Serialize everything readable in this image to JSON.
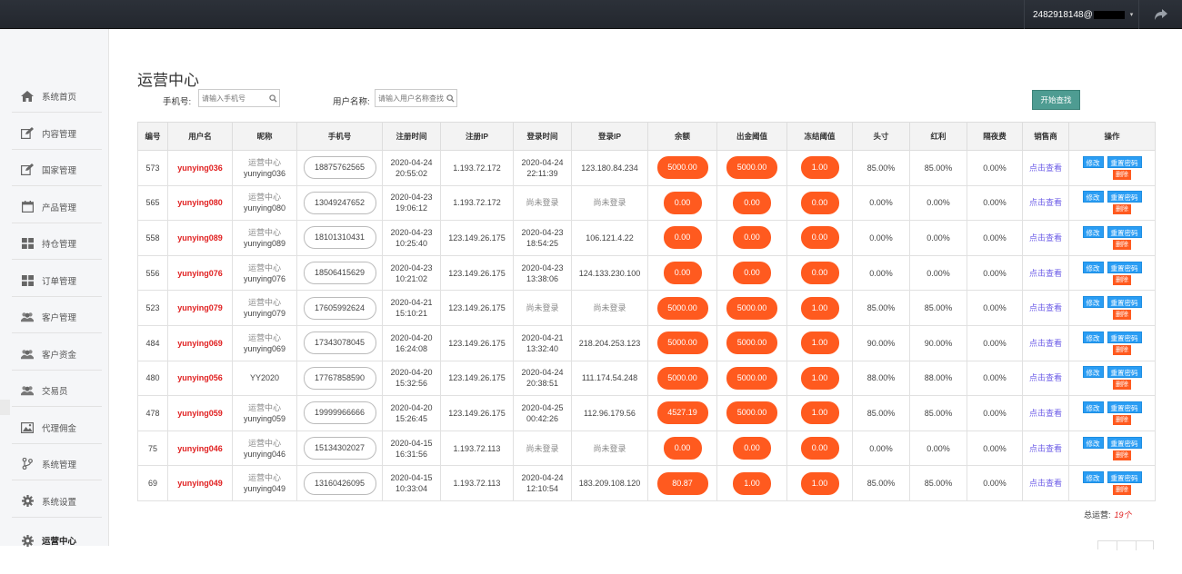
{
  "topbar": {
    "user": "2482918148@",
    "caret": "▾"
  },
  "sidebar": {
    "items": [
      {
        "label": "系统首页",
        "icon": "home-icon"
      },
      {
        "label": "内容管理",
        "icon": "edit-icon"
      },
      {
        "label": "国家管理",
        "icon": "edit-icon"
      },
      {
        "label": "产品管理",
        "icon": "calendar-icon"
      },
      {
        "label": "持仓管理",
        "icon": "grid-icon"
      },
      {
        "label": "订单管理",
        "icon": "grid-icon"
      },
      {
        "label": "客户管理",
        "icon": "users-icon"
      },
      {
        "label": "客户资金",
        "icon": "users-icon"
      },
      {
        "label": "交易员",
        "icon": "users-icon"
      },
      {
        "label": "代理佣金",
        "icon": "image-icon"
      },
      {
        "label": "系统管理",
        "icon": "branch-icon"
      },
      {
        "label": "系统设置",
        "icon": "gear-icon"
      },
      {
        "label": "运营中心",
        "icon": "gear-icon"
      }
    ]
  },
  "page": {
    "title": "运营中心",
    "phone_label": "手机号:",
    "phone_placeholder": "请输入手机号",
    "user_label": "用户名称:",
    "user_placeholder": "请输入用户名称查找",
    "search_button": "开始查找"
  },
  "table": {
    "headers": [
      "编号",
      "用户名",
      "昵称",
      "手机号",
      "注册时间",
      "注册IP",
      "登录时间",
      "登录IP",
      "余额",
      "出金阈值",
      "冻结阈值",
      "头寸",
      "红利",
      "隔夜费",
      "销售商",
      "操作"
    ],
    "view_label": "点击查看",
    "edit_label": "修改",
    "reset_label": "重置密码",
    "delete_label": "删除",
    "rows": [
      {
        "id": "573",
        "username": "yunying036",
        "nick1": "运营中心",
        "nick2": "yunying036",
        "phone": "18875762565",
        "reg_date": "2020-04-24",
        "reg_time": "20:55:02",
        "reg_ip": "1.193.72.172",
        "login_date": "2020-04-24",
        "login_time": "22:11:39",
        "login_ip": "123.180.84.234",
        "balance": "5000.00",
        "withdraw": "5000.00",
        "freeze": "1.00",
        "position": "85.00%",
        "bonus": "85.00%",
        "overnight": "0.00%"
      },
      {
        "id": "565",
        "username": "yunying080",
        "nick1": "运营中心",
        "nick2": "yunying080",
        "phone": "13049247652",
        "reg_date": "2020-04-23",
        "reg_time": "19:06:12",
        "reg_ip": "1.193.72.172",
        "login_date": "尚未登录",
        "login_time": "",
        "login_ip": "尚未登录",
        "balance": "0.00",
        "withdraw": "0.00",
        "freeze": "0.00",
        "position": "0.00%",
        "bonus": "0.00%",
        "overnight": "0.00%"
      },
      {
        "id": "558",
        "username": "yunying089",
        "nick1": "运营中心",
        "nick2": "yunying089",
        "phone": "18101310431",
        "reg_date": "2020-04-23",
        "reg_time": "10:25:40",
        "reg_ip": "123.149.26.175",
        "login_date": "2020-04-23",
        "login_time": "18:54:25",
        "login_ip": "106.121.4.22",
        "balance": "0.00",
        "withdraw": "0.00",
        "freeze": "0.00",
        "position": "0.00%",
        "bonus": "0.00%",
        "overnight": "0.00%"
      },
      {
        "id": "556",
        "username": "yunying076",
        "nick1": "运营中心",
        "nick2": "yunying076",
        "phone": "18506415629",
        "reg_date": "2020-04-23",
        "reg_time": "10:21:02",
        "reg_ip": "123.149.26.175",
        "login_date": "2020-04-23",
        "login_time": "13:38:06",
        "login_ip": "124.133.230.100",
        "balance": "0.00",
        "withdraw": "0.00",
        "freeze": "0.00",
        "position": "0.00%",
        "bonus": "0.00%",
        "overnight": "0.00%"
      },
      {
        "id": "523",
        "username": "yunying079",
        "nick1": "运营中心",
        "nick2": "yunying079",
        "phone": "17605992624",
        "reg_date": "2020-04-21",
        "reg_time": "15:10:21",
        "reg_ip": "123.149.26.175",
        "login_date": "尚未登录",
        "login_time": "",
        "login_ip": "尚未登录",
        "balance": "5000.00",
        "withdraw": "5000.00",
        "freeze": "1.00",
        "position": "85.00%",
        "bonus": "85.00%",
        "overnight": "0.00%"
      },
      {
        "id": "484",
        "username": "yunying069",
        "nick1": "运营中心",
        "nick2": "yunying069",
        "phone": "17343078045",
        "reg_date": "2020-04-20",
        "reg_time": "16:24:08",
        "reg_ip": "123.149.26.175",
        "login_date": "2020-04-21",
        "login_time": "13:32:40",
        "login_ip": "218.204.253.123",
        "balance": "5000.00",
        "withdraw": "5000.00",
        "freeze": "1.00",
        "position": "90.00%",
        "bonus": "90.00%",
        "overnight": "0.00%"
      },
      {
        "id": "480",
        "username": "yunying056",
        "nick1": "YY2020",
        "nick2": "",
        "phone": "17767858590",
        "reg_date": "2020-04-20",
        "reg_time": "15:32:56",
        "reg_ip": "123.149.26.175",
        "login_date": "2020-04-24",
        "login_time": "20:38:51",
        "login_ip": "111.174.54.248",
        "balance": "5000.00",
        "withdraw": "5000.00",
        "freeze": "1.00",
        "position": "88.00%",
        "bonus": "88.00%",
        "overnight": "0.00%"
      },
      {
        "id": "478",
        "username": "yunying059",
        "nick1": "运营中心",
        "nick2": "yunying059",
        "phone": "19999966666",
        "reg_date": "2020-04-20",
        "reg_time": "15:26:45",
        "reg_ip": "123.149.26.175",
        "login_date": "2020-04-25",
        "login_time": "00:42:26",
        "login_ip": "112.96.179.56",
        "balance": "4527.19",
        "withdraw": "5000.00",
        "freeze": "1.00",
        "position": "85.00%",
        "bonus": "85.00%",
        "overnight": "0.00%"
      },
      {
        "id": "75",
        "username": "yunying046",
        "nick1": "运营中心",
        "nick2": "yunying046",
        "phone": "15134302027",
        "reg_date": "2020-04-15",
        "reg_time": "16:31:56",
        "reg_ip": "1.193.72.113",
        "login_date": "尚未登录",
        "login_time": "",
        "login_ip": "尚未登录",
        "balance": "0.00",
        "withdraw": "0.00",
        "freeze": "0.00",
        "position": "0.00%",
        "bonus": "0.00%",
        "overnight": "0.00%"
      },
      {
        "id": "69",
        "username": "yunying049",
        "nick1": "运营中心",
        "nick2": "yunying049",
        "phone": "13160426095",
        "reg_date": "2020-04-15",
        "reg_time": "10:33:04",
        "reg_ip": "1.193.72.113",
        "login_date": "2020-04-24",
        "login_time": "12:10:54",
        "login_ip": "183.209.108.120",
        "balance": "80.87",
        "withdraw": "1.00",
        "freeze": "1.00",
        "position": "85.00%",
        "bonus": "85.00%",
        "overnight": "0.00%"
      }
    ]
  },
  "footer": {
    "total_label": "总运营:",
    "total_count": "19个"
  },
  "colors": {
    "accent_orange": "#ff5a1f",
    "username_red": "#e02020",
    "button_blue": "#2a9df4",
    "search_teal": "#4e9c92",
    "topbar_dark": "#2c3139"
  }
}
